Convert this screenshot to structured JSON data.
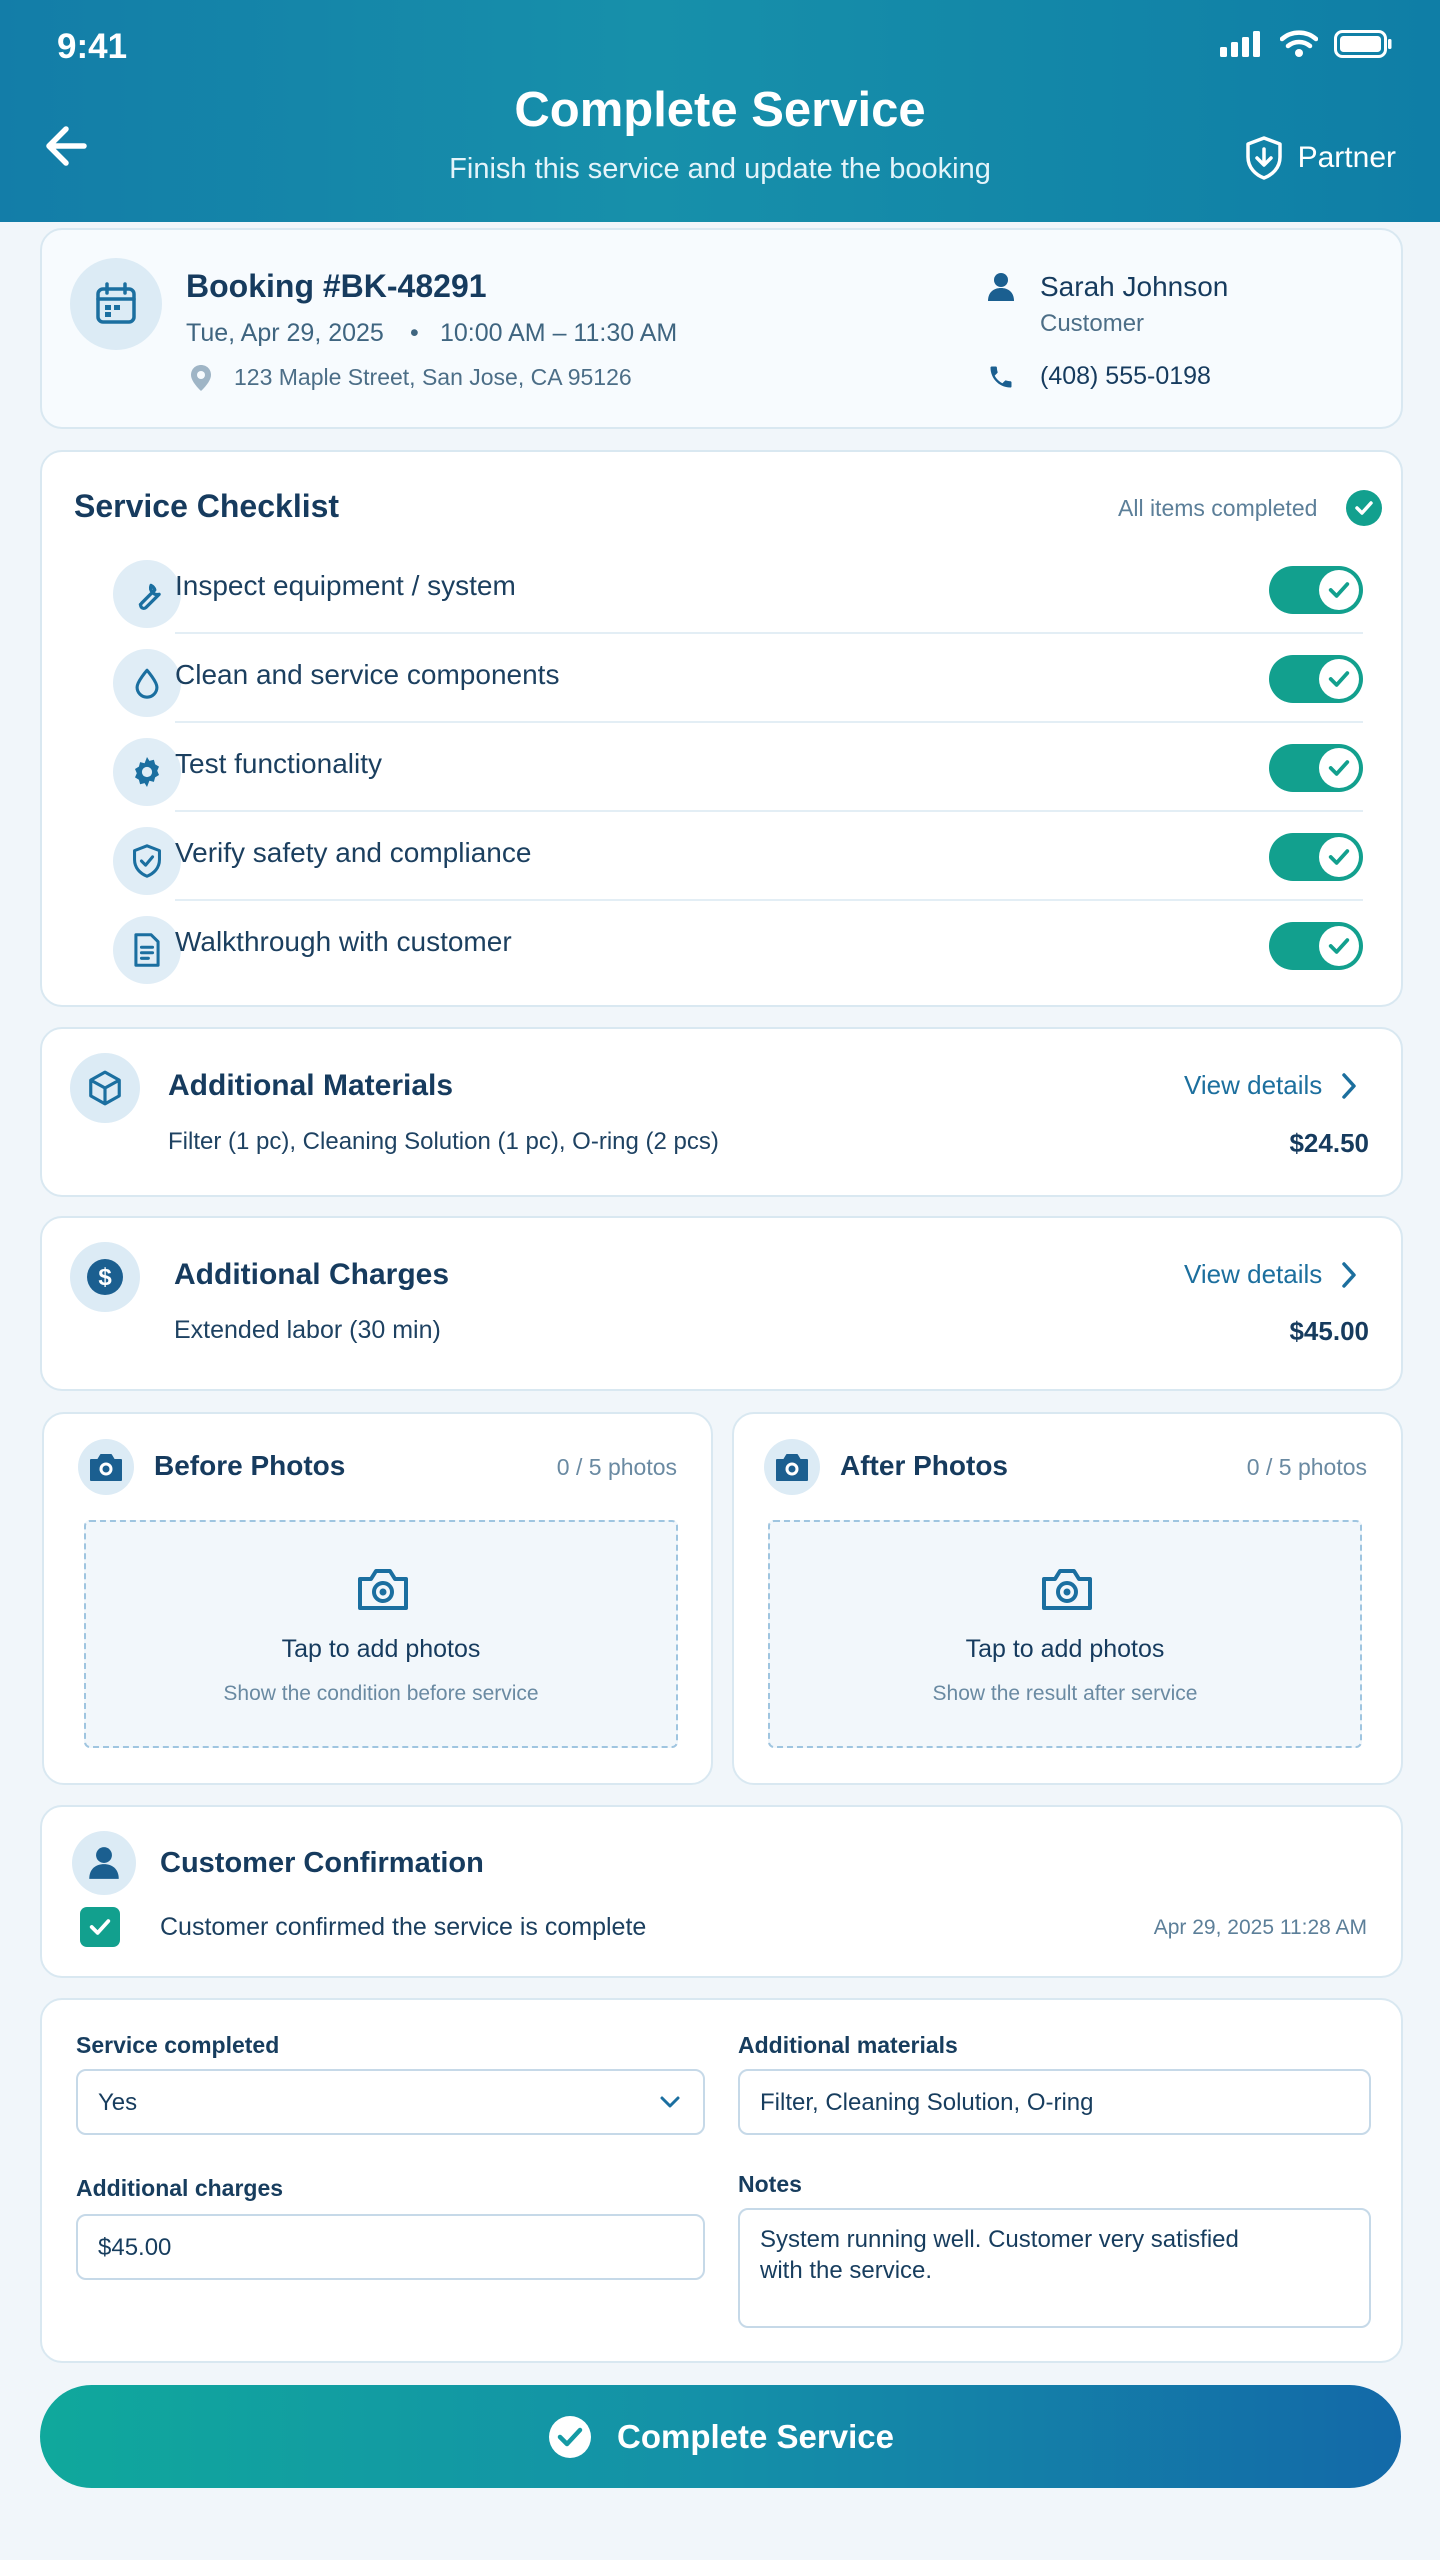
{
  "status_bar": {
    "time": "9:41"
  },
  "header": {
    "title": "Complete Service",
    "subtitle": "Finish this service and update the booking",
    "partner_label": "Partner"
  },
  "booking": {
    "title": "Booking #BK-48291",
    "date": "Tue, Apr 29, 2025",
    "separator": "•",
    "time": "10:00 AM – 11:30 AM",
    "address": "123 Maple Street, San Jose, CA 95126",
    "customer_name": "Sarah Johnson",
    "customer_role": "Customer",
    "phone": "(408) 555-0198"
  },
  "checklist": {
    "title": "Service Checklist",
    "status": "All items completed",
    "items": [
      {
        "label": "Inspect equipment / system",
        "icon": "wrench-icon",
        "checked": true
      },
      {
        "label": "Clean and service components",
        "icon": "droplet-icon",
        "checked": true
      },
      {
        "label": "Test functionality",
        "icon": "gear-icon",
        "checked": true
      },
      {
        "label": "Verify safety and compliance",
        "icon": "shield-check-icon",
        "checked": true
      },
      {
        "label": "Walkthrough with customer",
        "icon": "document-icon",
        "checked": true
      }
    ]
  },
  "materials": {
    "title": "Additional Materials",
    "link": "View details",
    "description": "Filter (1 pc), Cleaning Solution (1 pc), O-ring (2 pcs)",
    "amount": "$24.50"
  },
  "charges": {
    "title": "Additional Charges",
    "link": "View details",
    "description": "Extended labor (30 min)",
    "amount": "$45.00"
  },
  "photos": {
    "before": {
      "title": "Before Photos",
      "count": "0 / 5 photos",
      "cta": "Tap to add photos",
      "hint": "Show the condition before service"
    },
    "after": {
      "title": "After Photos",
      "count": "0 / 5 photos",
      "cta": "Tap to add photos",
      "hint": "Show the result after service"
    }
  },
  "confirmation": {
    "title": "Customer Confirmation",
    "text": "Customer confirmed the service is complete",
    "timestamp": "Apr 29, 2025 11:28 AM",
    "checked": true
  },
  "form": {
    "service_completed_label": "Service completed",
    "service_completed_value": "Yes",
    "materials_label": "Additional materials",
    "materials_value": "Filter, Cleaning Solution, O-ring",
    "charges_label": "Additional charges",
    "charges_value": "$45.00",
    "notes_label": "Notes",
    "notes_line1": "System running well. Customer very satisfied",
    "notes_line2": "with the service."
  },
  "cta": {
    "label": "Complete Service"
  },
  "colors": {
    "header": "#137da8",
    "accent_teal": "#12a08e",
    "text_dark": "#163b5e",
    "link": "#1c6f9e"
  }
}
